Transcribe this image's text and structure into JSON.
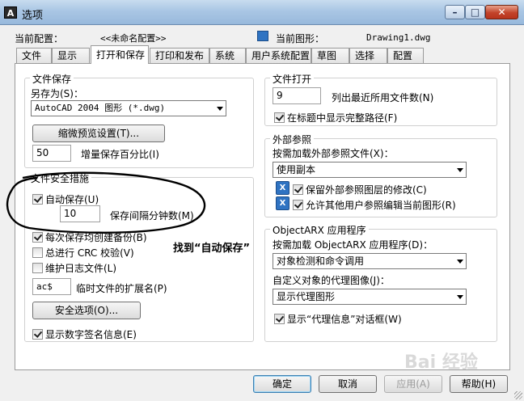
{
  "window": {
    "title": "选项",
    "icon": "A"
  },
  "profile": {
    "label": "当前配置：",
    "value": "<<未命名配置>>",
    "drawing_label": "当前图形：",
    "drawing_value": "Drawing1.dwg"
  },
  "tabs": [
    "文件",
    "显示",
    "打开和保存",
    "打印和发布",
    "系统",
    "用户系统配置",
    "草图",
    "选择",
    "配置"
  ],
  "active_tab": "打开和保存",
  "file_save": {
    "title": "文件保存",
    "save_as_label": "另存为(S)：",
    "save_as_value": "AutoCAD 2004 图形 (*.dwg)",
    "thumbnail_button": "缩微预览设置(T)...",
    "increment_value": "50",
    "increment_label": "增量保存百分比(I)"
  },
  "file_safety": {
    "title": "文件安全措施",
    "autosave_label": "自动保存(U)",
    "autosave_checked": true,
    "minutes_value": "10",
    "minutes_label": "保存间隔分钟数(M)",
    "backup_label": "每次保存均创建备份(B)",
    "backup_checked": true,
    "crc_label": "总进行 CRC 校验(V)",
    "crc_checked": false,
    "log_label": "维护日志文件(L)",
    "log_checked": false,
    "temp_ext_value": "ac$",
    "temp_ext_label": "临时文件的扩展名(P)",
    "security_button": "安全选项(O)...",
    "signature_label": "显示数字签名信息(E)",
    "signature_checked": true
  },
  "annotation": "找到“自动保存”",
  "file_open": {
    "title": "文件打开",
    "recent_value": "9",
    "recent_label": "列出最近所用文件数(N)",
    "fullpath_label": "在标题中显示完整路径(F)",
    "fullpath_checked": true
  },
  "xref": {
    "title": "外部参照",
    "demand_label": "按需加载外部参照文件(X)：",
    "demand_value": "使用副本",
    "retain_label": "保留外部参照图层的修改(C)",
    "retain_checked": true,
    "allow_label": "允许其他用户参照编辑当前图形(R)",
    "allow_checked": true
  },
  "objectarx": {
    "title": "ObjectARX 应用程序",
    "demand_label": "按需加载 ObjectARX 应用程序(D)：",
    "demand_value": "对象检测和命令调用",
    "proxy_label": "自定义对象的代理图像(J)：",
    "proxy_value": "显示代理图形",
    "dialog_label": "显示“代理信息”对话框(W)",
    "dialog_checked": true
  },
  "buttons": {
    "ok": "确定",
    "cancel": "取消",
    "apply": "应用(A)",
    "help": "帮助(H)"
  },
  "watermark": "Bai 经验"
}
